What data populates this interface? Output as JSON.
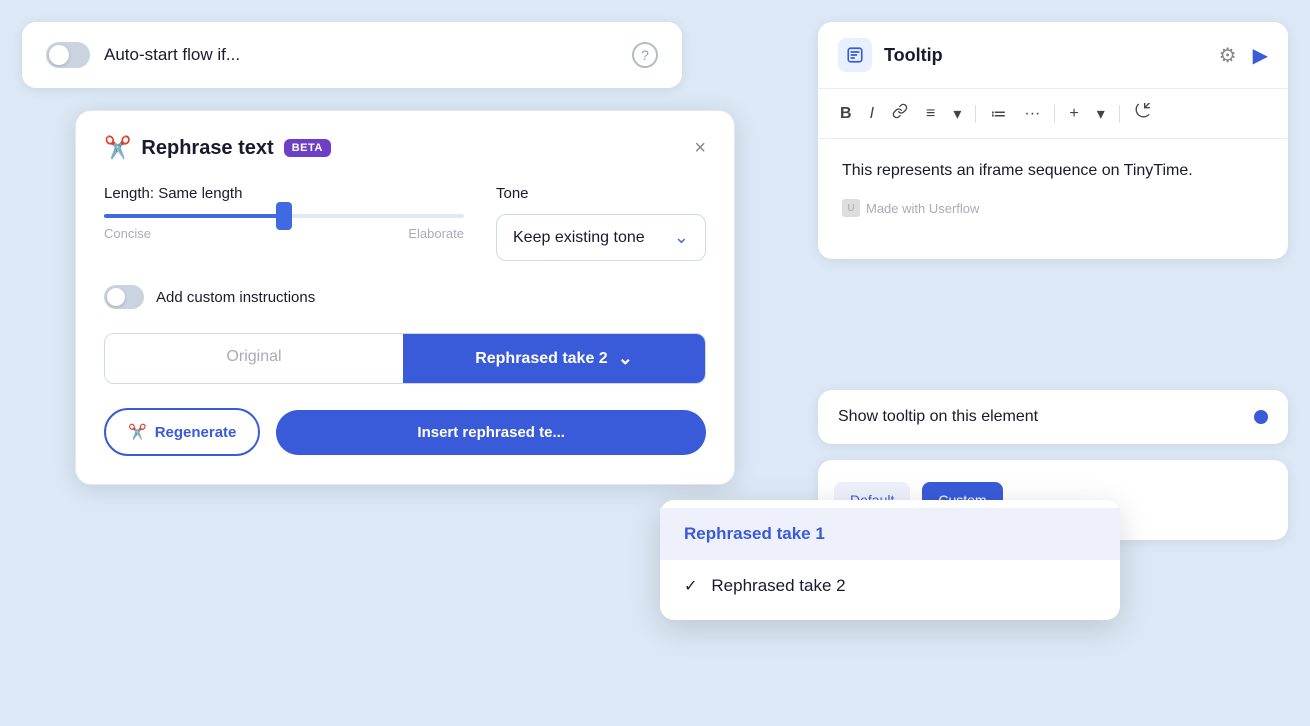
{
  "autostart": {
    "label": "Auto-start flow if...",
    "help_icon": "?"
  },
  "rephrase_dialog": {
    "title": "Rephrase text",
    "beta_label": "BETA",
    "close_label": "×",
    "length_label": "Length: Same length",
    "length_concise": "Concise",
    "length_elaborate": "Elaborate",
    "tone_label": "Tone",
    "tone_value": "Keep existing tone",
    "custom_instructions_label": "Add custom instructions",
    "tab_original": "Original",
    "tab_rephrased": "Rephrased take 2",
    "regenerate_label": "Regenerate",
    "insert_label": "Insert rephrased te..."
  },
  "dropdown": {
    "items": [
      {
        "label": "Rephrased take 1",
        "highlighted": true,
        "checked": false
      },
      {
        "label": "Rephrased take 2",
        "highlighted": false,
        "checked": true
      }
    ]
  },
  "tooltip_panel": {
    "title": "Tooltip",
    "editor_text": "This represents an iframe sequence on TinyTime.",
    "userflow_label": "Made with Userflow"
  },
  "show_tooltip": {
    "label": "Show tooltip on this element"
  },
  "toolbar": {
    "bold": "B",
    "italic": "I",
    "link": "🔗",
    "align": "≡",
    "chevron": "▾",
    "list": "≔",
    "more": "···",
    "plus": "+",
    "magic": "✦"
  }
}
